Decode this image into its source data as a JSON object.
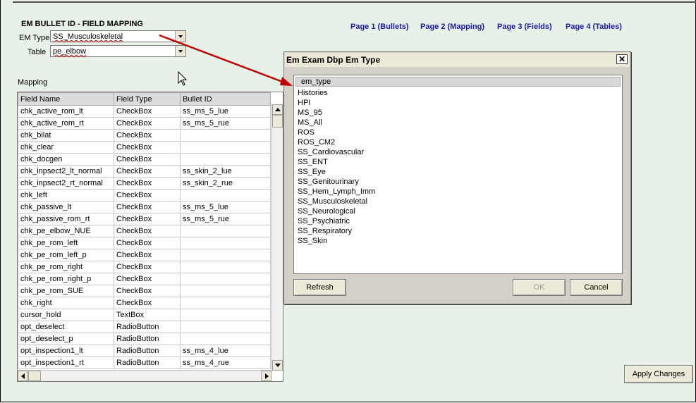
{
  "header": {
    "title": "EM BULLET ID - FIELD MAPPING"
  },
  "em_type": {
    "label": "EM Type",
    "value": "SS_Musculoskeletal"
  },
  "table_field": {
    "label": "Table",
    "value": "pe_elbow"
  },
  "mapping_label": "Mapping",
  "pages": [
    {
      "label": "Page 1 (Bullets)"
    },
    {
      "label": "Page 2 (Mapping)"
    },
    {
      "label": "Page 3 (Fields)"
    },
    {
      "label": "Page 4 (Tables)"
    }
  ],
  "grid": {
    "columns": [
      "Field Name",
      "Field Type",
      "Bullet ID"
    ],
    "rows": [
      [
        "chk_active_rom_lt",
        "CheckBox",
        "ss_ms_5_lue"
      ],
      [
        "chk_active_rom_rt",
        "CheckBox",
        "ss_ms_5_rue"
      ],
      [
        "chk_bilat",
        "CheckBox",
        ""
      ],
      [
        "chk_clear",
        "CheckBox",
        ""
      ],
      [
        "chk_docgen",
        "CheckBox",
        ""
      ],
      [
        "chk_inpsect2_lt_normal",
        "CheckBox",
        "ss_skin_2_lue"
      ],
      [
        "chk_inpsect2_rt_normal",
        "CheckBox",
        "ss_skin_2_rue"
      ],
      [
        "chk_left",
        "CheckBox",
        ""
      ],
      [
        "chk_passive_lt",
        "CheckBox",
        "ss_ms_5_lue"
      ],
      [
        "chk_passive_rom_rt",
        "CheckBox",
        "ss_ms_5_rue"
      ],
      [
        "chk_pe_elbow_NUE",
        "CheckBox",
        ""
      ],
      [
        "chk_pe_rom_left",
        "CheckBox",
        ""
      ],
      [
        "chk_pe_rom_left_p",
        "CheckBox",
        ""
      ],
      [
        "chk_pe_rom_right",
        "CheckBox",
        ""
      ],
      [
        "chk_pe_rom_right_p",
        "CheckBox",
        ""
      ],
      [
        "chk_pe_rom_SUE",
        "CheckBox",
        ""
      ],
      [
        "chk_right",
        "CheckBox",
        ""
      ],
      [
        "cursor_hold",
        "TextBox",
        ""
      ],
      [
        "opt_deselect",
        "RadioButton",
        ""
      ],
      [
        "opt_deselect_p",
        "RadioButton",
        ""
      ],
      [
        "opt_inspection1_lt",
        "RadioButton",
        "ss_ms_4_lue"
      ],
      [
        "opt_inspection1_rt",
        "RadioButton",
        "ss_ms_4_rue"
      ]
    ]
  },
  "apply_button": "Apply Changes",
  "dialog": {
    "title": "Em Exam Dbp Em Type",
    "close_glyph": "✕",
    "list_header": "em_type",
    "items": [
      "Histories",
      "HPI",
      "MS_95",
      "MS_All",
      "ROS",
      "ROS_CM2",
      "SS_Cardiovascular",
      "SS_ENT",
      "SS_Eye",
      "SS_Genitourinary",
      "SS_Hem_Lymph_Imm",
      "SS_Musculoskeletal",
      "SS_Neurological",
      "SS_Psychiatric",
      "SS_Respiratory",
      "SS_Skin"
    ],
    "refresh_button": "Refresh",
    "ok_button": "OK",
    "cancel_button": "Cancel"
  },
  "colors": {
    "background": "#e8f1e7",
    "link": "#1a1aa6",
    "arrow": "#c00000"
  }
}
